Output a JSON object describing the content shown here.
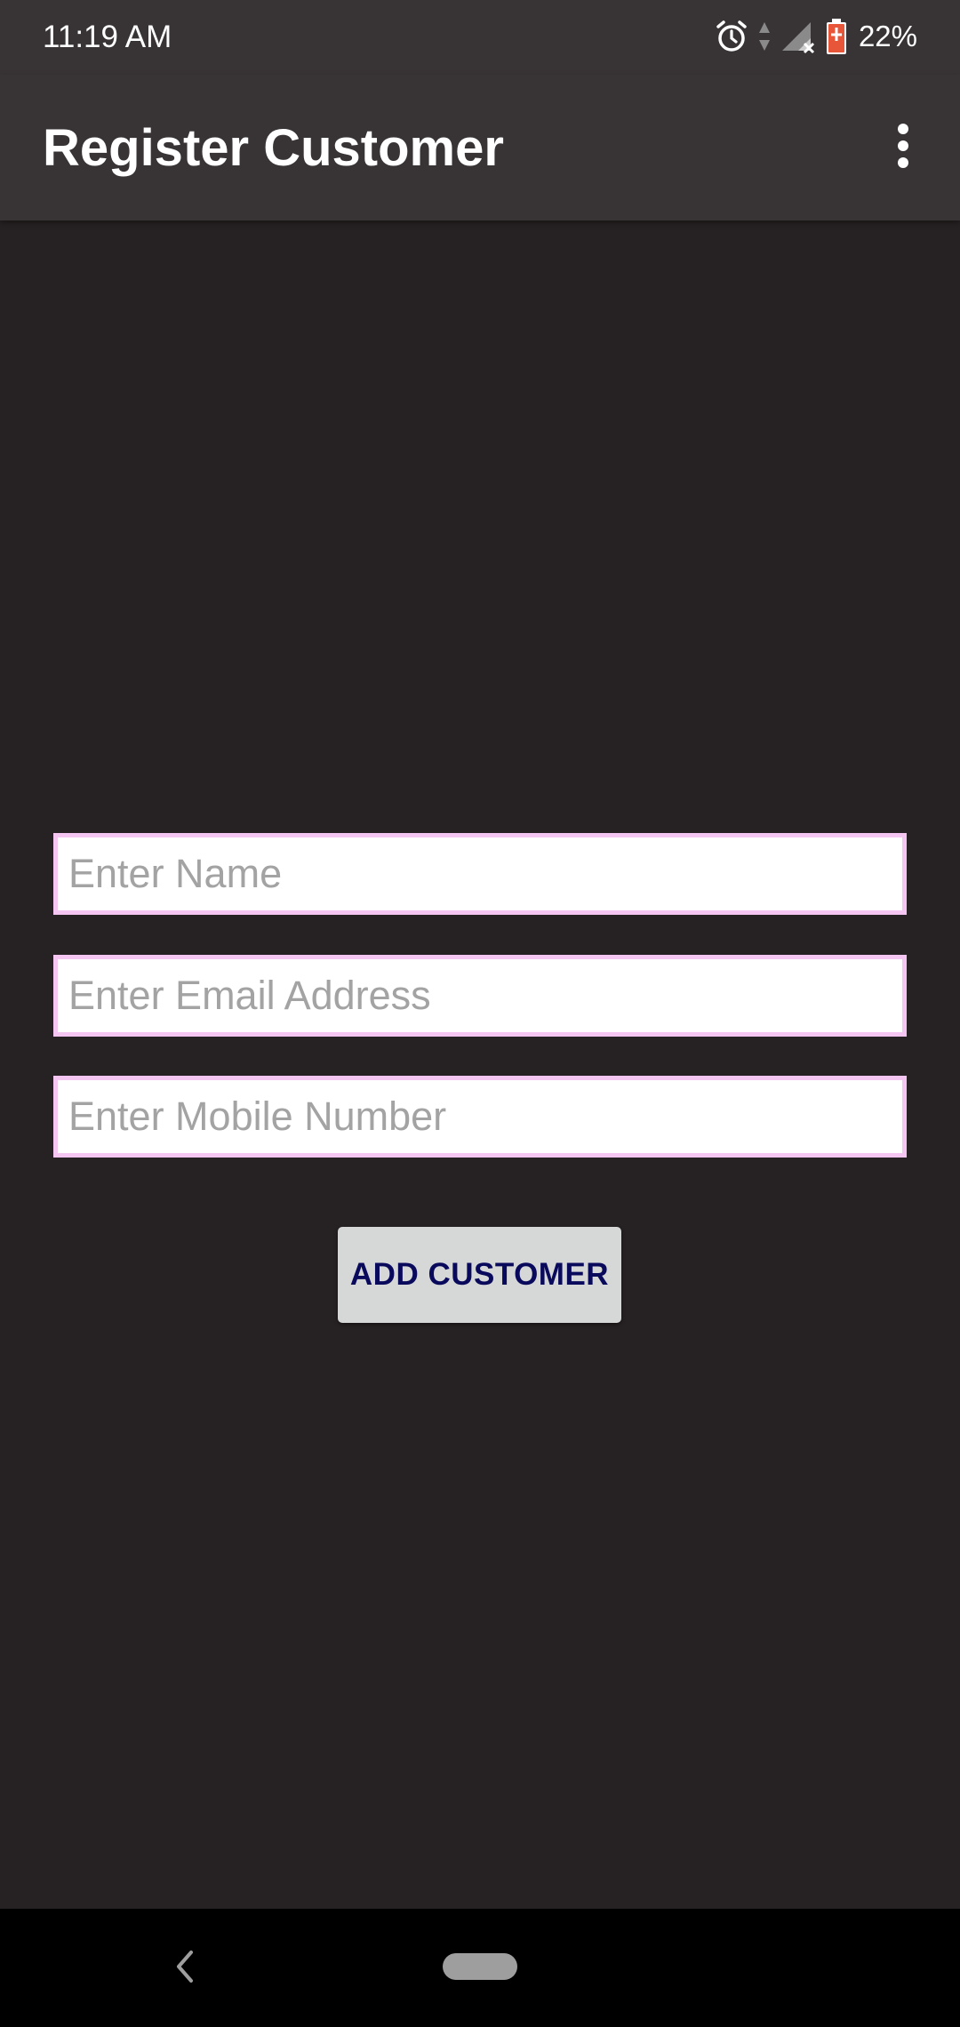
{
  "status_bar": {
    "time": "11:19 AM",
    "battery_percent": "22%",
    "icons": [
      "alarm-icon",
      "data-arrows-icon",
      "signal-no-service-icon",
      "battery-low-icon"
    ]
  },
  "app_bar": {
    "title": "Register Customer",
    "menu_icon": "more-vert-icon"
  },
  "form": {
    "name": {
      "value": "",
      "placeholder": "Enter Name"
    },
    "email": {
      "value": "",
      "placeholder": "Enter Email Address"
    },
    "mobile": {
      "value": "",
      "placeholder": "Enter Mobile Number"
    },
    "submit_label": "ADD CUSTOMER"
  },
  "nav_bar": {
    "back_icon": "chevron-left-icon",
    "home_icon": "home-pill-icon"
  },
  "colors": {
    "background": "#262122",
    "app_bar": "#383334",
    "field_border": "#f6c6f2",
    "button_bg": "#d6d7d7",
    "button_text": "#0a0a5c",
    "battery_accent": "#e8563a"
  }
}
